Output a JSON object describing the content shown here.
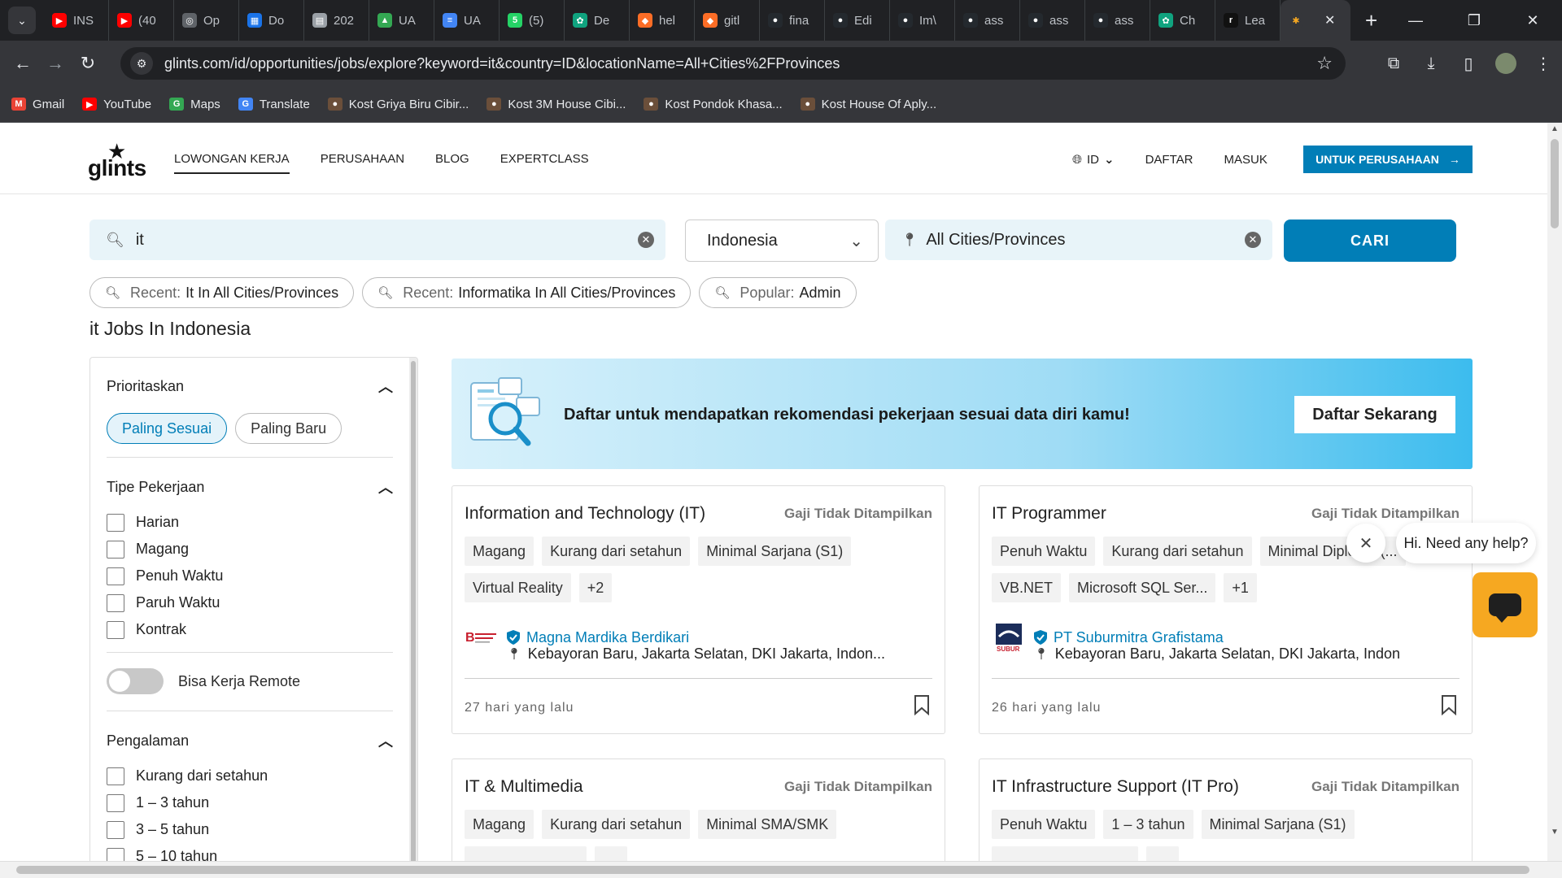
{
  "browser": {
    "tabs": [
      {
        "label": "INS",
        "color": "#ff0000",
        "glyph": "▶"
      },
      {
        "label": "(40",
        "color": "#ff0000",
        "glyph": "▶"
      },
      {
        "label": "Op",
        "color": "#5f6368",
        "glyph": "◎"
      },
      {
        "label": "Do",
        "color": "#1a73e8",
        "glyph": "▦"
      },
      {
        "label": "202",
        "color": "#9aa0a6",
        "glyph": "▤"
      },
      {
        "label": "UA",
        "color": "#34a853",
        "glyph": "▲"
      },
      {
        "label": "UA",
        "color": "#4285f4",
        "glyph": "≡"
      },
      {
        "label": "(5)",
        "color": "#25d366",
        "glyph": "5"
      },
      {
        "label": "De",
        "color": "#10a37f",
        "glyph": "✿"
      },
      {
        "label": "hel",
        "color": "#fc6d26",
        "glyph": "◆"
      },
      {
        "label": "gitl",
        "color": "#fc6d26",
        "glyph": "◆"
      },
      {
        "label": "fina",
        "color": "#24292e",
        "glyph": "●"
      },
      {
        "label": "Edi",
        "color": "#24292e",
        "glyph": "●"
      },
      {
        "label": "Im\\",
        "color": "#24292e",
        "glyph": "●"
      },
      {
        "label": "ass",
        "color": "#24292e",
        "glyph": "●"
      },
      {
        "label": "ass",
        "color": "#24292e",
        "glyph": "●"
      },
      {
        "label": "ass",
        "color": "#24292e",
        "glyph": "●"
      },
      {
        "label": "Ch",
        "color": "#10a37f",
        "glyph": "✿"
      },
      {
        "label": "Lea",
        "color": "#111111",
        "glyph": "r"
      }
    ],
    "url": "glints.com/id/opportunities/jobs/explore?keyword=it&country=ID&locationName=All+Cities%2FProvinces",
    "bookmarks": [
      {
        "label": "Gmail",
        "color": "#ea4335",
        "glyph": "M"
      },
      {
        "label": "YouTube",
        "color": "#ff0000",
        "glyph": "▶"
      },
      {
        "label": "Maps",
        "color": "#34a853",
        "glyph": "G"
      },
      {
        "label": "Translate",
        "color": "#4285f4",
        "glyph": "G"
      },
      {
        "label": "Kost Griya Biru Cibir...",
        "color": "#6b4f3a",
        "glyph": "●"
      },
      {
        "label": "Kost 3M House Cibi...",
        "color": "#6b4f3a",
        "glyph": "●"
      },
      {
        "label": "Kost Pondok Khasa...",
        "color": "#6b4f3a",
        "glyph": "●"
      },
      {
        "label": "Kost House Of Aply...",
        "color": "#6b4f3a",
        "glyph": "●"
      }
    ]
  },
  "site": {
    "logo": "glints",
    "nav": [
      "LOWONGAN KERJA",
      "PERUSAHAAN",
      "BLOG",
      "EXPERTCLASS"
    ],
    "lang": "ID",
    "register": "DAFTAR",
    "login": "MASUK",
    "company_btn": "UNTUK PERUSAHAAN",
    "accent": "#017eb7"
  },
  "search": {
    "keyword": "it",
    "country": "Indonesia",
    "location": "All Cities/Provinces",
    "button": "CARI",
    "chips": [
      {
        "prefix": "Recent:",
        "text": "It In All Cities/Provinces"
      },
      {
        "prefix": "Recent:",
        "text": "Informatika In All Cities/Provinces"
      },
      {
        "prefix": "Popular:",
        "text": "Admin"
      }
    ]
  },
  "results_title": "it Jobs In Indonesia",
  "filters": {
    "priority": {
      "title": "Prioritaskan",
      "options": [
        "Paling Sesuai",
        "Paling Baru"
      ]
    },
    "job_type": {
      "title": "Tipe Pekerjaan",
      "options": [
        "Harian",
        "Magang",
        "Penuh Waktu",
        "Paruh Waktu",
        "Kontrak"
      ]
    },
    "remote": "Bisa Kerja Remote",
    "experience": {
      "title": "Pengalaman",
      "options": [
        "Kurang dari setahun",
        "1 – 3 tahun",
        "3 – 5 tahun",
        "5 – 10 tahun"
      ]
    }
  },
  "banner": {
    "text": "Daftar untuk mendapatkan rekomendasi pekerjaan sesuai data diri kamu!",
    "button": "Daftar Sekarang"
  },
  "jobs": [
    {
      "title": "Information and Technology (IT)",
      "salary": "Gaji Tidak Ditampilkan",
      "tags_row1": [
        "Magang",
        "Kurang dari setahun",
        "Minimal Sarjana (S1)"
      ],
      "tags_row2": [
        "Virtual Reality",
        "+2"
      ],
      "company": "Magna Mardika Berdikari",
      "location": "Kebayoran Baru, Jakarta Selatan, DKI Jakarta, Indon...",
      "posted": "27 hari yang lalu"
    },
    {
      "title": "IT Programmer",
      "salary": "Gaji Tidak Ditampilkan",
      "tags_row1": [
        "Penuh Waktu",
        "Kurang dari setahun",
        "Minimal Diploma (..."
      ],
      "tags_row2": [
        "VB.NET",
        "Microsoft SQL Ser...",
        "+1"
      ],
      "company": "PT Suburmitra Grafistama",
      "location": "Kebayoran Baru, Jakarta Selatan, DKI Jakarta, Indon",
      "posted": "26 hari yang lalu"
    },
    {
      "title": "IT & Multimedia",
      "salary": "Gaji Tidak Ditampilkan",
      "tags_row1": [
        "Magang",
        "Kurang dari setahun",
        "Minimal SMA/SMK"
      ]
    },
    {
      "title": "IT Infrastructure Support (IT Pro)",
      "salary": "Gaji Tidak Ditampilkan",
      "tags_row1": [
        "Penuh Waktu",
        "1 – 3 tahun",
        "Minimal Sarjana (S1)"
      ]
    }
  ],
  "chat": {
    "greeting": "Hi. Need any help?"
  }
}
